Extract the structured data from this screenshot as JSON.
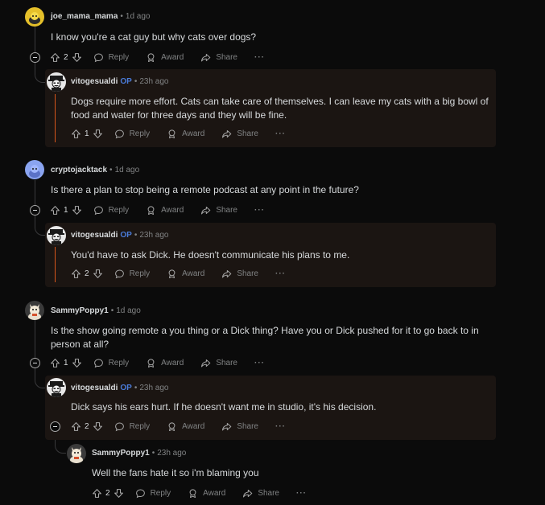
{
  "comments": [
    {
      "username": "joe_mama_mama",
      "time": "1d ago",
      "text": "I know you're a cat guy but why cats over dogs?",
      "score": "2",
      "reply": "Reply",
      "award": "Award",
      "share": "Share",
      "more": "···"
    },
    {
      "username": "vitogesualdi",
      "op": "OP",
      "time": "23h ago",
      "text": "Dogs require more effort. Cats can take care of themselves. I can leave my cats with a big bowl of food and water for three days and they will be fine.",
      "score": "1",
      "reply": "Reply",
      "award": "Award",
      "share": "Share",
      "more": "···"
    },
    {
      "username": "cryptojacktack",
      "time": "1d ago",
      "text": "Is there a plan to stop being a remote podcast at any point in the future?",
      "score": "1",
      "reply": "Reply",
      "award": "Award",
      "share": "Share",
      "more": "···"
    },
    {
      "username": "vitogesualdi",
      "op": "OP",
      "time": "23h ago",
      "text": "You'd have to ask Dick. He doesn't communicate his plans to me.",
      "score": "2",
      "reply": "Reply",
      "award": "Award",
      "share": "Share",
      "more": "···"
    },
    {
      "username": "SammyPoppy1",
      "time": "1d ago",
      "text": "Is the show going remote a you thing or a Dick thing? Have you or Dick pushed for it to go back to in person at all?",
      "score": "1",
      "reply": "Reply",
      "award": "Award",
      "share": "Share",
      "more": "···"
    },
    {
      "username": "vitogesualdi",
      "op": "OP",
      "time": "23h ago",
      "text": "Dick says his ears hurt. If he doesn't want me in studio, it's his decision.",
      "score": "2",
      "reply": "Reply",
      "award": "Award",
      "share": "Share",
      "more": "···"
    },
    {
      "username": "SammyPoppy1",
      "time": "23h ago",
      "text": "Well the fans hate it so i'm blaming you",
      "score": "2",
      "reply": "Reply",
      "award": "Award",
      "share": "Share",
      "more": "···"
    }
  ],
  "colors": {
    "accent_op": "#4a7bd8",
    "thread_highlight": "#d8561c",
    "background": "#0b0b0b",
    "reply_bg": "#1b1512"
  }
}
